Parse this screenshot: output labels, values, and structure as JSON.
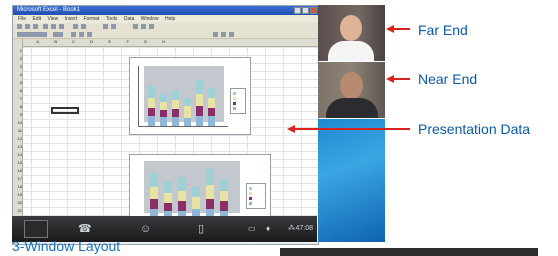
{
  "window": {
    "title": "Microsoft Excel - Book1"
  },
  "menu": [
    "File",
    "Edit",
    "View",
    "Insert",
    "Format",
    "Tools",
    "Data",
    "Window",
    "Help"
  ],
  "sheet": {
    "columns": [
      "A",
      "B",
      "C",
      "D",
      "E",
      "F",
      "G",
      "H"
    ],
    "rows": [
      "1",
      "2",
      "3",
      "4",
      "5",
      "6",
      "7",
      "8",
      "9",
      "10",
      "11",
      "12",
      "13",
      "14",
      "15",
      "16",
      "17",
      "18",
      "19",
      "20",
      "21",
      "22"
    ]
  },
  "labels": {
    "far_end": "Far End",
    "near_end": "Near End",
    "presentation_data": "Presentation Data"
  },
  "caption": "3-Window Layout",
  "taskbar": {
    "clock": "47:08"
  },
  "icons": [
    "spreadsheet-icon",
    "phone-icon",
    "person-icon",
    "document-icon",
    "camera-icon",
    "microphone-icon",
    "network-icon"
  ],
  "colors": {
    "accent": "#0b5aa6",
    "arrow": "#d8231f",
    "bar_blue": "#8fb8d8",
    "bar_yellow": "#e8e3a4",
    "bar_purple": "#8b2f66",
    "bar_teal": "#9fd0d6"
  }
}
